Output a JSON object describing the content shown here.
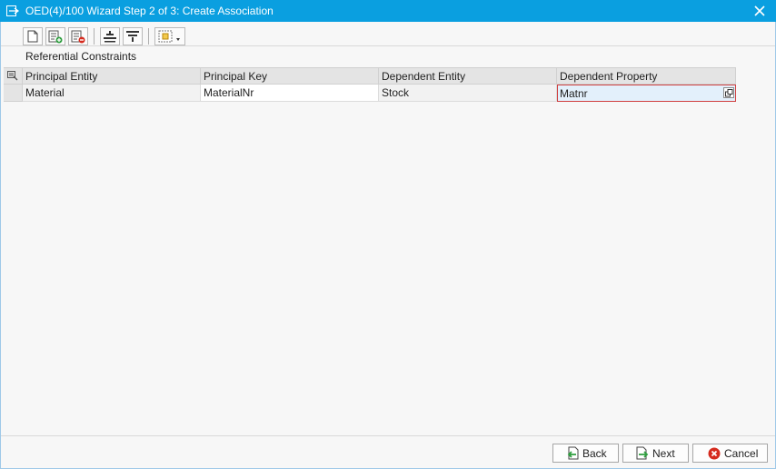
{
  "window": {
    "title": "OED(4)/100 Wizard Step 2 of 3: Create Association",
    "app_icon": "window-menu-icon",
    "close_icon": "close-icon"
  },
  "toolbar": {
    "buttons": [
      {
        "name": "new-entry-button",
        "icon": "new-document-icon"
      },
      {
        "name": "insert-row-button",
        "icon": "insert-row-icon"
      },
      {
        "name": "delete-row-button",
        "icon": "delete-row-icon"
      },
      {
        "name": "align-button",
        "icon": "align-icon"
      },
      {
        "name": "filter-button",
        "icon": "filter-icon"
      },
      {
        "name": "layout-button",
        "icon": "layout-dropdown-icon"
      }
    ]
  },
  "section": {
    "title": "Referential Constraints"
  },
  "grid": {
    "columns": [
      "Principal Entity",
      "Principal Key",
      "Dependent Entity",
      "Dependent Property"
    ],
    "rows": [
      {
        "principal_entity": "Material",
        "principal_key": "MaterialNr",
        "dependent_entity": "Stock",
        "dependent_property": "Matnr"
      }
    ]
  },
  "footer": {
    "back_label": "Back",
    "next_label": "Next",
    "cancel_label": "Cancel"
  },
  "colors": {
    "titlebar": "#0a9fe0",
    "focus_border": "#d04040",
    "cancel_red": "#d52b1e",
    "arrow_green": "#2f9e3f"
  }
}
